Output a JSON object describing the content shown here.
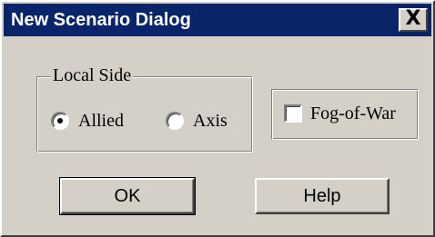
{
  "window": {
    "title": "New Scenario Dialog",
    "close_glyph": "X"
  },
  "local_side": {
    "legend": "Local Side",
    "options": [
      {
        "label": "Allied",
        "selected": true
      },
      {
        "label": "Axis",
        "selected": false
      }
    ]
  },
  "fog_of_war": {
    "label": "Fog-of-War",
    "checked": false
  },
  "buttons": {
    "ok": "OK",
    "help": "Help"
  },
  "colors": {
    "titlebar": "#0a246a",
    "face": "#d4d0c8"
  }
}
